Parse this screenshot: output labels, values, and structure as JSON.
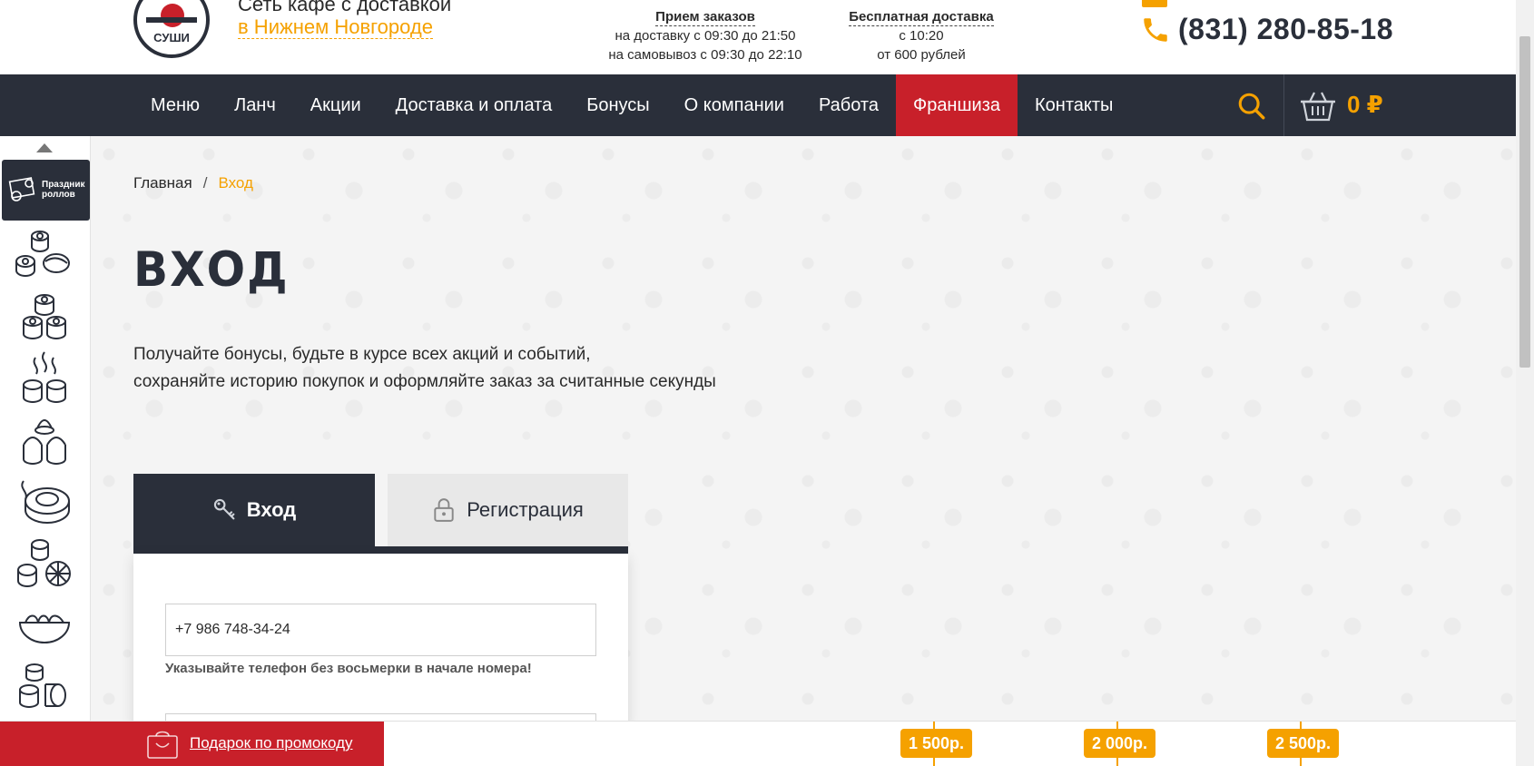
{
  "header": {
    "brand_line1": "Сеть кафе с доставкой",
    "brand_city": "в Нижнем Новгороде",
    "logo_text": "СУШИ",
    "orders_title": "Прием заказов",
    "orders_delivery": "на доставку с 09:30 до 21:50",
    "orders_pickup": "на самовывоз с 09:30 до 22:10",
    "delivery_title": "Бесплатная доставка",
    "delivery_from_time": "с 10:20",
    "delivery_min": "от 600 рублей",
    "phone": "(831) 280-85-18",
    "phone_icon": "phone-icon"
  },
  "nav": {
    "items": [
      {
        "label": "Меню"
      },
      {
        "label": "Ланч"
      },
      {
        "label": "Акции"
      },
      {
        "label": "Доставка и оплата"
      },
      {
        "label": "Бонусы"
      },
      {
        "label": "О компании"
      },
      {
        "label": "Работа"
      },
      {
        "label": "Франшиза",
        "active": true
      },
      {
        "label": "Контакты"
      }
    ],
    "cart_sum": "0 ₽",
    "search_icon": "search-icon",
    "cart_icon": "basket-icon"
  },
  "sidebar": {
    "promo_label_line1": "Праздник",
    "promo_label_line2": "роллов",
    "categories": [
      "sushi-set-icon",
      "rolls-icon",
      "hot-rolls-icon",
      "cream-rolls-icon",
      "baked-rolls-icon",
      "citrus-rolls-icon",
      "noodles-icon",
      "mini-rolls-icon"
    ]
  },
  "breadcrumb": {
    "home": "Главная",
    "separator": "/",
    "current": "Вход"
  },
  "main": {
    "title": "ВХОД",
    "lead_line1": "Получайте бонусы, будьте в курсе всех акций и событий,",
    "lead_line2": "сохраняйте историю покупок и оформляйте заказ за считанные секунды",
    "tab_login": "Вход",
    "tab_register": "Регистрация",
    "phone_value": "+7 986 748-34-24",
    "phone_hint": "Указывайте телефон без восьмерки в начале номера!"
  },
  "bottom": {
    "promo_label": "Подарок по промокоду",
    "thresholds": [
      "1 500р.",
      "2 000р.",
      "2 500р."
    ]
  },
  "colors": {
    "dark": "#2a2f3a",
    "accent": "#f5a100",
    "red": "#c8202a"
  }
}
